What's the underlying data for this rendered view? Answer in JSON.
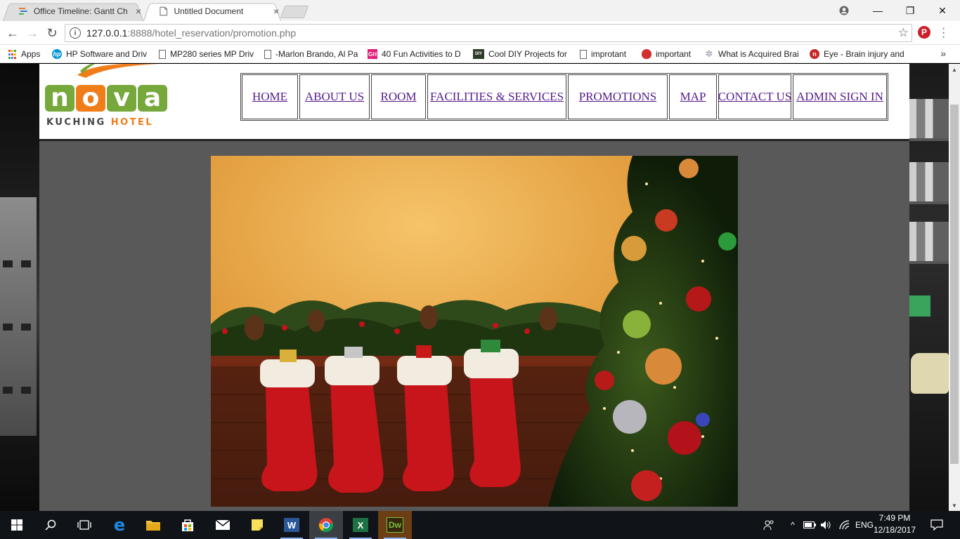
{
  "browser": {
    "tabs": [
      {
        "title": "Office Timeline: Gantt Ch",
        "icon": "office-timeline-icon",
        "active": false
      },
      {
        "title": "Untitled Document",
        "icon": "document-icon",
        "active": true
      }
    ],
    "close_glyph": "×",
    "window_controls": {
      "account": "account-icon",
      "minimize": "—",
      "restore": "❐",
      "close": "✕"
    },
    "address": {
      "host": "127.0.0.1",
      "path": ":8888/hotel_reservation/promotion.php"
    },
    "bookmarks": [
      {
        "label": "Apps",
        "icon": "apps-grid-icon"
      },
      {
        "label": "HP Software and Driv",
        "icon": "hp-icon"
      },
      {
        "label": "MP280 series MP Driv",
        "icon": "file-icon"
      },
      {
        "label": "-Marlon Brando, Al Pa",
        "icon": "file-icon"
      },
      {
        "label": "40 Fun Activities to D",
        "icon": "gh-icon",
        "icon_text": "GH"
      },
      {
        "label": "Cool DIY Projects for",
        "icon": "diy-icon",
        "icon_text": "DIY"
      },
      {
        "label": "improtant",
        "icon": "file-icon"
      },
      {
        "label": "important",
        "icon": "apple-icon"
      },
      {
        "label": "What is Acquired Brai",
        "icon": "gear-icon"
      },
      {
        "label": "Eye - Brain injury and",
        "icon": "eye-site-icon",
        "icon_text": "n"
      }
    ],
    "more_bookmarks": "»"
  },
  "site": {
    "logo": {
      "word": [
        "n",
        "o",
        "v",
        "a"
      ],
      "sub_left": "KUCHING",
      "sub_right": "HOTEL"
    },
    "nav": [
      "HOME",
      "ABOUT US",
      "ROOM",
      "FACILITIES & SERVICES",
      "PROMOTIONS",
      "MAP",
      "CONTACT US",
      "ADMIN SIGN IN"
    ],
    "promo_image": "christmas-stockings-tree-image"
  },
  "taskbar": {
    "apps": [
      "start-windows-icon",
      "search-icon",
      "task-view-icon",
      "edge-icon",
      "file-explorer-icon",
      "store-icon",
      "mail-icon",
      "sticky-notes-icon",
      "word-icon",
      "chrome-icon",
      "excel-icon",
      "dreamweaver-icon"
    ],
    "dw_label": "Dw",
    "word_label": "W",
    "excel_label": "X",
    "language": "ENG",
    "time": "7:49 PM",
    "date": "12/18/2017"
  },
  "colors": {
    "nav_link": "#551a8b",
    "logo_green": "#77a83c",
    "logo_orange": "#ef7d1a",
    "page_bg": "#595959"
  }
}
